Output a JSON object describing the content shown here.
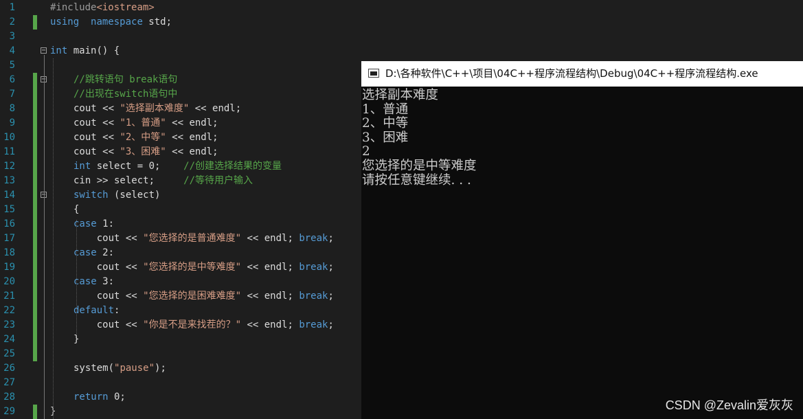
{
  "editor": {
    "lines": [
      {
        "n": "1",
        "parts": [
          [
            "pp",
            "#include"
          ],
          [
            "inc",
            "<iostream>"
          ]
        ]
      },
      {
        "n": "2",
        "parts": [
          [
            "kw",
            "using"
          ],
          [
            "",
            "  "
          ],
          [
            "kw",
            "namespace"
          ],
          [
            "",
            " std;"
          ]
        ]
      },
      {
        "n": "3",
        "parts": []
      },
      {
        "n": "4",
        "parts": [
          [
            "kw",
            "int"
          ],
          [
            "",
            " main() {"
          ]
        ]
      },
      {
        "n": "5",
        "parts": []
      },
      {
        "n": "6",
        "parts": [
          [
            "",
            ""
          ],
          [
            "cmt",
            "//跳转语句 break语句"
          ]
        ]
      },
      {
        "n": "7",
        "parts": [
          [
            "cmt",
            "//出现在switch语句中"
          ]
        ]
      },
      {
        "n": "8",
        "parts": [
          [
            "",
            "cout << "
          ],
          [
            "str",
            "\"选择副本难度\""
          ],
          [
            "",
            " << endl;"
          ]
        ]
      },
      {
        "n": "9",
        "parts": [
          [
            "",
            "cout << "
          ],
          [
            "str",
            "\"1、普通\""
          ],
          [
            "",
            " << endl;"
          ]
        ]
      },
      {
        "n": "10",
        "parts": [
          [
            "",
            "cout << "
          ],
          [
            "str",
            "\"2、中等\""
          ],
          [
            "",
            " << endl;"
          ]
        ]
      },
      {
        "n": "11",
        "parts": [
          [
            "",
            "cout << "
          ],
          [
            "str",
            "\"3、困难\""
          ],
          [
            "",
            " << endl;"
          ]
        ]
      },
      {
        "n": "12",
        "parts": [
          [
            "kw",
            "int"
          ],
          [
            "",
            " select = 0;    "
          ],
          [
            "cmt",
            "//创建选择结果的变量"
          ]
        ]
      },
      {
        "n": "13",
        "parts": [
          [
            "",
            "cin >> select;     "
          ],
          [
            "cmt",
            "//等待用户输入"
          ]
        ]
      },
      {
        "n": "14",
        "parts": [
          [
            "kw",
            "switch"
          ],
          [
            "",
            " (select)"
          ]
        ]
      },
      {
        "n": "15",
        "parts": [
          [
            "",
            "{"
          ]
        ]
      },
      {
        "n": "16",
        "parts": [
          [
            "kw",
            "case"
          ],
          [
            "",
            " 1:"
          ]
        ]
      },
      {
        "n": "17",
        "parts": [
          [
            "",
            "    cout << "
          ],
          [
            "str",
            "\"您选择的是普通难度\""
          ],
          [
            "",
            " << endl; "
          ],
          [
            "kw",
            "break"
          ],
          [
            "",
            ";"
          ]
        ]
      },
      {
        "n": "18",
        "parts": [
          [
            "kw",
            "case"
          ],
          [
            "",
            " 2:"
          ]
        ]
      },
      {
        "n": "19",
        "parts": [
          [
            "",
            "    cout << "
          ],
          [
            "str",
            "\"您选择的是中等难度\""
          ],
          [
            "",
            " << endl; "
          ],
          [
            "kw",
            "break"
          ],
          [
            "",
            ";"
          ]
        ]
      },
      {
        "n": "20",
        "parts": [
          [
            "kw",
            "case"
          ],
          [
            "",
            " 3:"
          ]
        ]
      },
      {
        "n": "21",
        "parts": [
          [
            "",
            "    cout << "
          ],
          [
            "str",
            "\"您选择的是困难难度\""
          ],
          [
            "",
            " << endl; "
          ],
          [
            "kw",
            "break"
          ],
          [
            "",
            ";"
          ]
        ]
      },
      {
        "n": "22",
        "parts": [
          [
            "kw",
            "default"
          ],
          [
            "",
            ":"
          ]
        ]
      },
      {
        "n": "23",
        "parts": [
          [
            "",
            "    cout << "
          ],
          [
            "str",
            "\"你是不是来找茬的？\""
          ],
          [
            "",
            " << endl; "
          ],
          [
            "kw",
            "break"
          ],
          [
            "",
            ";"
          ]
        ]
      },
      {
        "n": "24",
        "parts": [
          [
            "",
            "}"
          ]
        ]
      },
      {
        "n": "25",
        "parts": []
      },
      {
        "n": "26",
        "parts": [
          [
            "",
            "system("
          ],
          [
            "str",
            "\"pause\""
          ],
          [
            "",
            ");"
          ]
        ]
      },
      {
        "n": "27",
        "parts": []
      },
      {
        "n": "28",
        "parts": [
          [
            "kw",
            "return"
          ],
          [
            "",
            " 0;"
          ]
        ]
      },
      {
        "n": "29",
        "parts": [
          [
            "",
            "}"
          ]
        ]
      }
    ]
  },
  "console": {
    "title": "D:\\各种软件\\C++\\项目\\04C++程序流程结构\\Debug\\04C++程序流程结构.exe",
    "output": "选择副本难度\n1、普通\n2、中等\n3、困难\n2\n您选择的是中等难度\n请按任意键继续. . ."
  },
  "watermark": "CSDN @Zevalin爱灰灰",
  "colors": {
    "editor_bg": "#1e1e1e",
    "keyword": "#569cd6",
    "string": "#d69d85",
    "comment": "#57a64a",
    "line_number": "#2b91af",
    "console_bg": "#0c0c0c"
  }
}
